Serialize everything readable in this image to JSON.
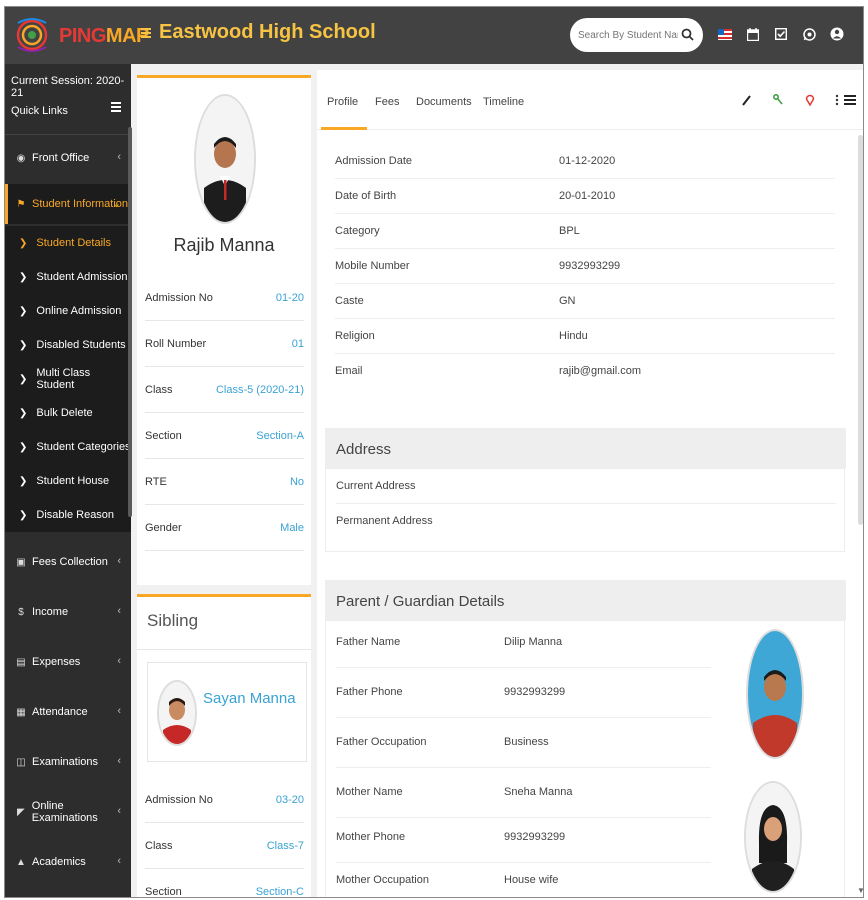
{
  "app": {
    "logo_text_1": "PING",
    "logo_text_2": "MAP",
    "school_name": "Eastwood High School",
    "search_placeholder": "Search By Student Name"
  },
  "topbar_icons": [
    "flag-icon",
    "calendar-icon",
    "checkbox-icon",
    "whatsapp-icon",
    "user-icon"
  ],
  "sidebar": {
    "session": "Current Session: 2020-21",
    "quick_links": "Quick Links",
    "items": [
      {
        "label": "Front Office",
        "icon": "front-office-icon"
      },
      {
        "label": "Student Information",
        "icon": "student-info-icon"
      },
      {
        "label": "Fees Collection",
        "icon": "fees-icon"
      },
      {
        "label": "Income",
        "icon": "income-icon"
      },
      {
        "label": "Expenses",
        "icon": "expenses-icon"
      },
      {
        "label": "Attendance",
        "icon": "attendance-icon"
      },
      {
        "label": "Examinations",
        "icon": "examinations-icon"
      },
      {
        "label": "Online Examinations",
        "icon": "online-exam-icon"
      },
      {
        "label": "Academics",
        "icon": "academics-icon"
      }
    ],
    "subitems": [
      "Student Details",
      "Student Admission",
      "Online Admission",
      "Disabled Students",
      "Multi Class Student",
      "Bulk Delete",
      "Student Categories",
      "Student House",
      "Disable Reason"
    ]
  },
  "profile": {
    "name": "Rajib Manna",
    "rows": [
      {
        "label": "Admission No",
        "value": "01-20"
      },
      {
        "label": "Roll Number",
        "value": "01"
      },
      {
        "label": "Class",
        "value": "Class-5 (2020-21)"
      },
      {
        "label": "Section",
        "value": "Section-A"
      },
      {
        "label": "RTE",
        "value": "No"
      },
      {
        "label": "Gender",
        "value": "Male"
      }
    ]
  },
  "sibling": {
    "title": "Sibling",
    "name": "Sayan Manna",
    "rows": [
      {
        "label": "Admission No",
        "value": "03-20"
      },
      {
        "label": "Class",
        "value": "Class-7"
      },
      {
        "label": "Section",
        "value": "Section-C"
      }
    ]
  },
  "tabs": [
    "Profile",
    "Fees",
    "Documents",
    "Timeline"
  ],
  "tab_actions": [
    "edit-icon",
    "key-icon",
    "location-icon",
    "more-icon",
    "list-icon"
  ],
  "details": [
    {
      "label": "Admission Date",
      "value": "01-12-2020"
    },
    {
      "label": "Date of Birth",
      "value": "20-01-2010"
    },
    {
      "label": "Category",
      "value": "BPL"
    },
    {
      "label": "Mobile Number",
      "value": "9932993299"
    },
    {
      "label": "Caste",
      "value": "GN"
    },
    {
      "label": "Religion",
      "value": "Hindu"
    },
    {
      "label": "Email",
      "value": "rajib@gmail.com"
    }
  ],
  "address": {
    "title": "Address",
    "rows": [
      {
        "label": "Current Address",
        "value": ""
      },
      {
        "label": "Permanent Address",
        "value": ""
      }
    ]
  },
  "guardian": {
    "title": "Parent / Guardian Details",
    "rows": [
      {
        "label": "Father Name",
        "value": "Dilip Manna"
      },
      {
        "label": "Father Phone",
        "value": "9932993299"
      },
      {
        "label": "Father Occupation",
        "value": "Business"
      },
      {
        "label": "Mother Name",
        "value": "Sneha Manna"
      },
      {
        "label": "Mother Phone",
        "value": "9932993299"
      },
      {
        "label": "Mother Occupation",
        "value": "House wife"
      }
    ]
  },
  "colors": {
    "accent": "#f9a825",
    "link": "#3aa2d4",
    "topbar": "#424242",
    "sidebar": "#2d2d2d"
  }
}
